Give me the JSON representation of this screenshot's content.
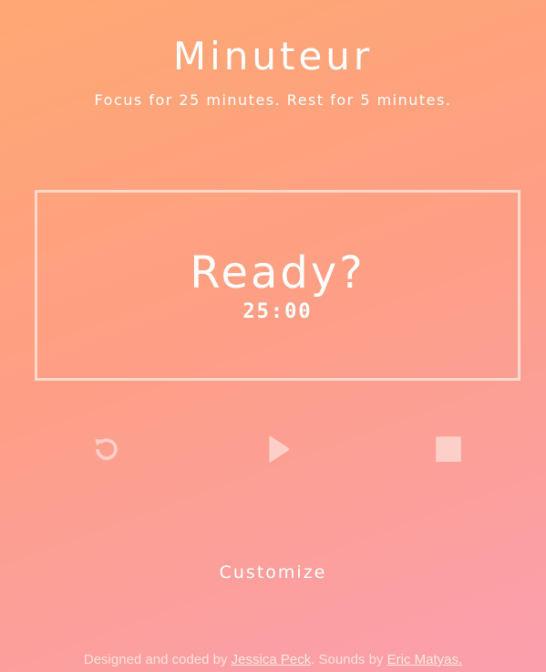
{
  "app": {
    "title": "Minuteur",
    "subtitle": "Focus for 25 minutes. Rest for 5 minutes."
  },
  "timer": {
    "status": "Ready?",
    "time": "25:00"
  },
  "controls": {
    "reset_icon": "reset-icon",
    "play_icon": "play-icon",
    "stop_icon": "stop-icon",
    "icon_color": "#fcd0c8"
  },
  "customize": {
    "label": "Customize"
  },
  "footer": {
    "prefix": "Designed and coded by ",
    "author_link": "Jessica Peck",
    "middle": ". Sounds by ",
    "sounds_link": "Eric Matyas."
  },
  "colors": {
    "gradient_start": "#ffa873",
    "gradient_end": "#fb9fae",
    "border": "#ffe2d6"
  }
}
